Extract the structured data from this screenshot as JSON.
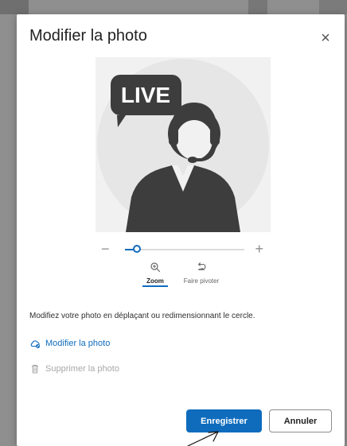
{
  "dialog": {
    "title": "Modifier la photo",
    "close_icon": "close-icon"
  },
  "photo": {
    "live_label": "LIVE",
    "background_color": "#f1f1f1",
    "circle_color": "#e6e6e6",
    "accent_color": "#3d3d3d"
  },
  "zoom": {
    "value": 0.1,
    "minus_label": "−",
    "plus_label": "+"
  },
  "tools": {
    "zoom_label": "Zoom",
    "rotate_label": "Faire pivoter",
    "zoom_icon": "zoom-in-icon",
    "rotate_icon": "rotate-icon"
  },
  "instructions": "Modifiez votre photo en déplaçant ou redimensionnant le cercle.",
  "actions": {
    "edit_label": "Modifier la photo",
    "delete_label": "Supprimer la photo"
  },
  "buttons": {
    "save_label": "Enregistrer",
    "cancel_label": "Annuler"
  },
  "colors": {
    "accent": "#0f6cbd",
    "text": "#2f2f2f",
    "disabled": "#a8a8a8"
  }
}
